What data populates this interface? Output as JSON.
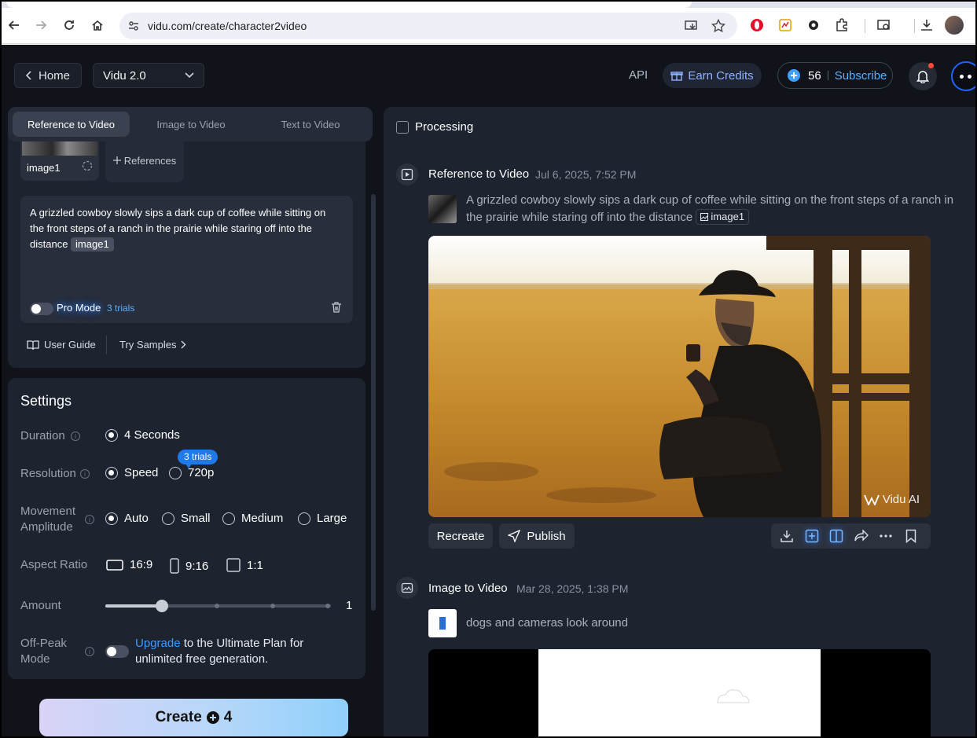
{
  "browser": {
    "url": "vidu.com/create/character2video"
  },
  "topbar": {
    "home_label": "Home",
    "model_label": "Vidu 2.0",
    "api_label": "API",
    "earn_label": "Earn Credits",
    "credits": "56",
    "subscribe_label": "Subscribe"
  },
  "mode_tabs": [
    {
      "label": "Reference to Video",
      "active": true
    },
    {
      "label": "Image to Video",
      "active": false
    },
    {
      "label": "Text to Video",
      "active": false
    }
  ],
  "references": {
    "image_label": "image1",
    "add_label": "References"
  },
  "prompt": {
    "text": "A grizzled cowboy slowly sips a dark cup of coffee while sitting on the front steps of a ranch in the prairie while staring off into the distance",
    "chip": "image1",
    "pro_mode_label": "Pro Mode",
    "trials_label": "3 trials"
  },
  "links": {
    "user_guide": "User Guide",
    "try_samples": "Try Samples"
  },
  "settings": {
    "title": "Settings",
    "duration_label": "Duration",
    "duration_option": "4 Seconds",
    "resolution_label": "Resolution",
    "resolution_options": [
      "Speed",
      "720p"
    ],
    "resolution_badge": "3 trials",
    "movement_label_1": "Movement",
    "movement_label_2": "Amplitude",
    "movement_options": [
      "Auto",
      "Small",
      "Medium",
      "Large"
    ],
    "aspect_label": "Aspect Ratio",
    "aspect_options": [
      "16:9",
      "9:16",
      "1:1"
    ],
    "amount_label": "Amount",
    "amount_value": "1",
    "amount_fraction": 0.25,
    "offpeak_label_1": "Off-Peak",
    "offpeak_label_2": "Mode",
    "offpeak_link": "Upgrade",
    "offpeak_text": " to the Ultimate Plan for unlimited free generation."
  },
  "create": {
    "label": "Create",
    "cost": "4"
  },
  "history": {
    "processing_label": "Processing",
    "items": [
      {
        "type": "Reference to Video",
        "date": "Jul 6, 2025, 7:52 PM",
        "prompt": "A grizzled cowboy slowly sips a dark cup of coffee while sitting on the front steps of a ranch in the prairie while staring off into the distance",
        "chip": "image1",
        "watermark": "Vidu AI",
        "recreate_label": "Recreate",
        "publish_label": "Publish"
      },
      {
        "type": "Image to Video",
        "date": "Mar 28, 2025, 1:38 PM",
        "prompt": "dogs and cameras look around"
      }
    ]
  },
  "colors": {
    "background": "#10131a",
    "panel": "#1e2330",
    "accent": "#3a9bff"
  }
}
